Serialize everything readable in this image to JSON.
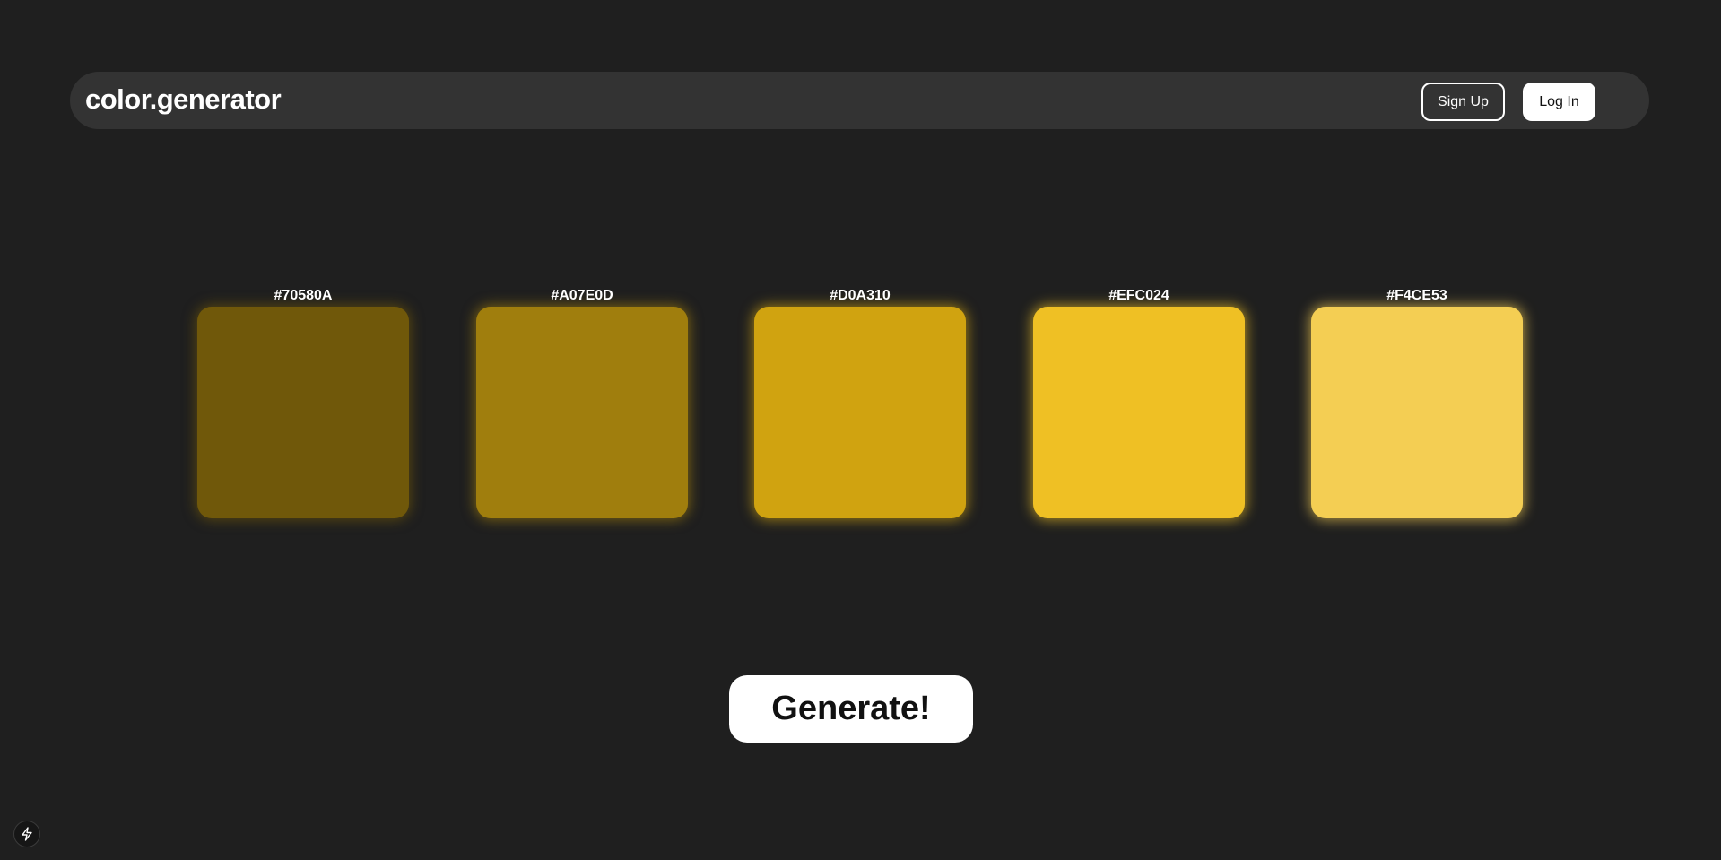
{
  "header": {
    "brand": "color.generator",
    "signup_label": "Sign Up",
    "login_label": "Log In"
  },
  "palette": {
    "swatches": [
      {
        "label": "#70580A",
        "color": "#70580A"
      },
      {
        "label": "#A07E0D",
        "color": "#A07E0D"
      },
      {
        "label": "#D0A310",
        "color": "#D0A310"
      },
      {
        "label": "#EFC024",
        "color": "#EFC024"
      },
      {
        "label": "#F4CE53",
        "color": "#F4CE53"
      }
    ]
  },
  "actions": {
    "generate_label": "Generate!"
  },
  "corner_badge": {
    "icon": "lightning-icon"
  }
}
